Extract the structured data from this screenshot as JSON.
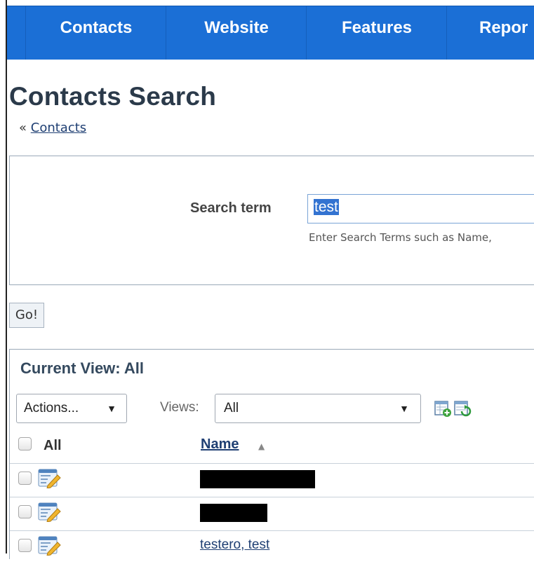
{
  "nav": {
    "items": [
      {
        "label": "Contacts"
      },
      {
        "label": "Website"
      },
      {
        "label": "Features"
      },
      {
        "label": "Repor"
      }
    ]
  },
  "page": {
    "title": "Contacts Search",
    "breadcrumb_prefix": "«",
    "breadcrumb_link": "Contacts"
  },
  "search": {
    "label": "Search term",
    "value": "test",
    "hint": "Enter Search Terms such as Name,",
    "go_label": "Go!"
  },
  "results": {
    "view_title": "Current View: All",
    "actions_label": "Actions...",
    "views_label": "Views:",
    "views_value": "All",
    "header_all": "All",
    "header_name": "Name",
    "rows": [
      {
        "name": "",
        "redacted": true
      },
      {
        "name": "",
        "redacted": true
      },
      {
        "name": "testero, test",
        "redacted": false
      }
    ]
  },
  "colors": {
    "nav_bg": "#1b6fd6",
    "link": "#1f3f73",
    "selection": "#3373d1"
  }
}
